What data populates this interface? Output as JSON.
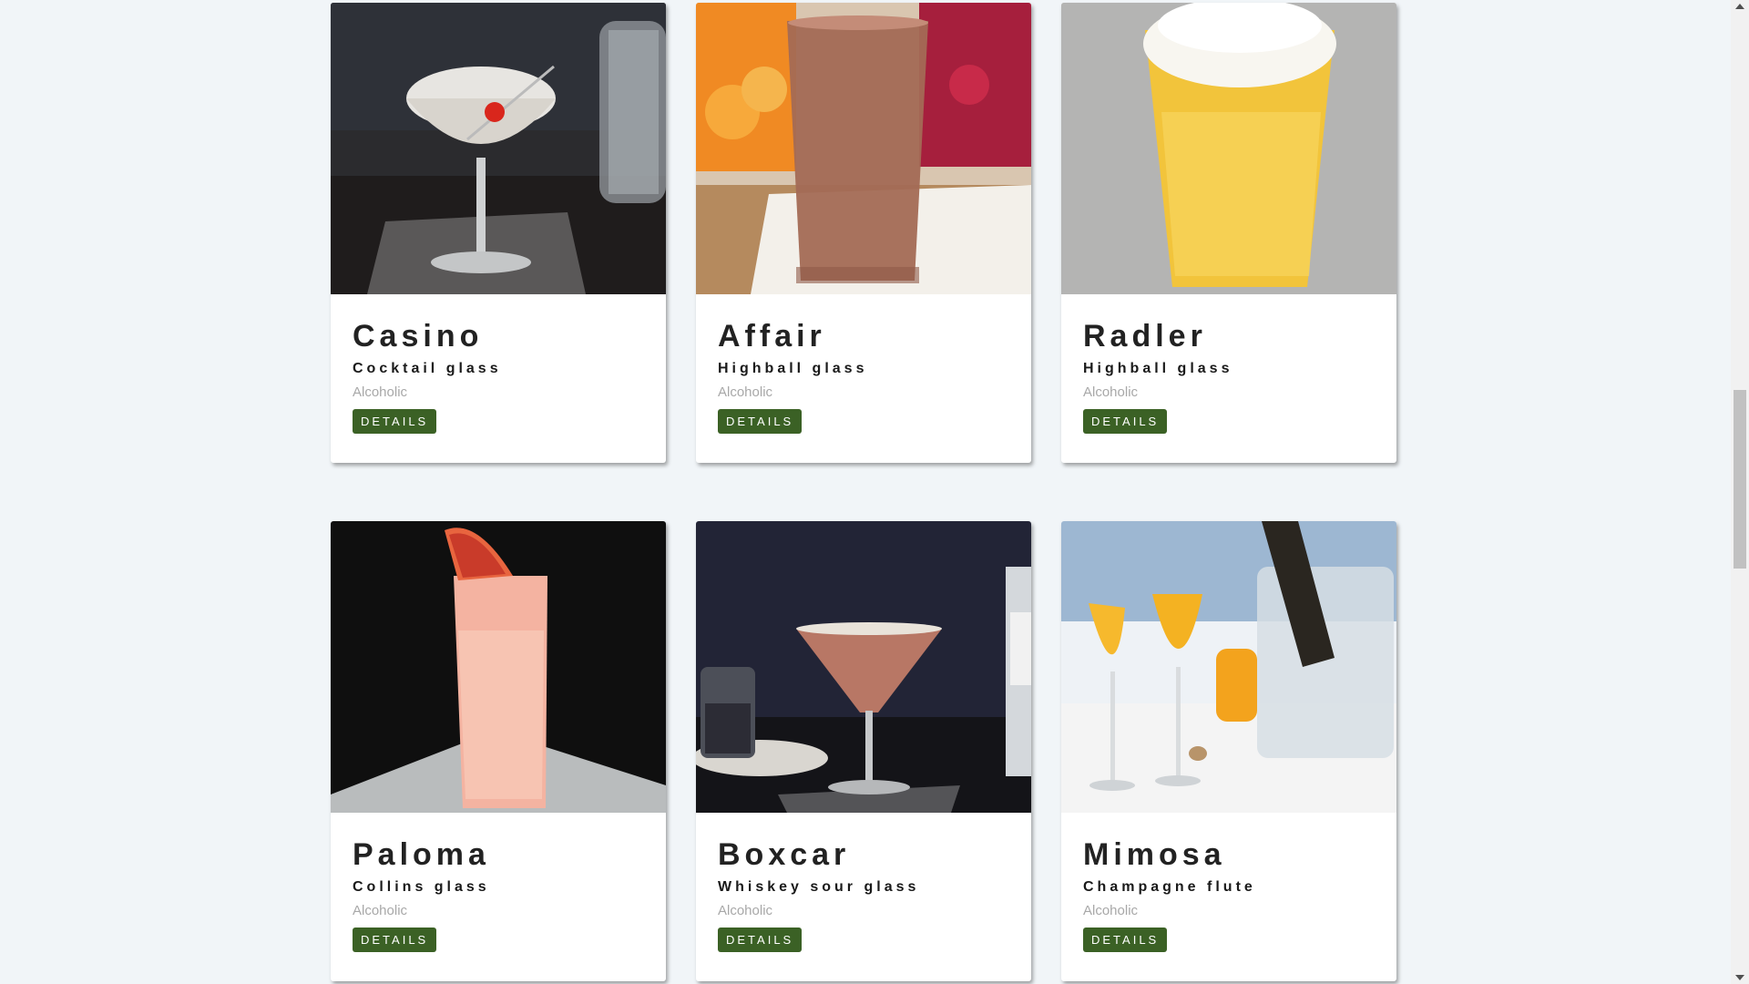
{
  "cards": [
    {
      "name": "Casino",
      "glass": "Cocktail glass",
      "category": "Alcoholic",
      "button": "DETAILS",
      "image_icon": "cocktail-glass-photo"
    },
    {
      "name": "Affair",
      "glass": "Highball glass",
      "category": "Alcoholic",
      "button": "DETAILS",
      "image_icon": "highball-glass-photo"
    },
    {
      "name": "Radler",
      "glass": "Highball glass",
      "category": "Alcoholic",
      "button": "DETAILS",
      "image_icon": "beer-glass-photo"
    },
    {
      "name": "Paloma",
      "glass": "Collins glass",
      "category": "Alcoholic",
      "button": "DETAILS",
      "image_icon": "collins-glass-photo"
    },
    {
      "name": "Boxcar",
      "glass": "Whiskey sour glass",
      "category": "Alcoholic",
      "button": "DETAILS",
      "image_icon": "martini-glass-photo"
    },
    {
      "name": "Mimosa",
      "glass": "Champagne flute",
      "category": "Alcoholic",
      "button": "DETAILS",
      "image_icon": "champagne-flute-photo"
    }
  ],
  "colors": {
    "background": "#f1f5f8",
    "button": "#3b6125",
    "muted_text": "#a8a8a8"
  }
}
